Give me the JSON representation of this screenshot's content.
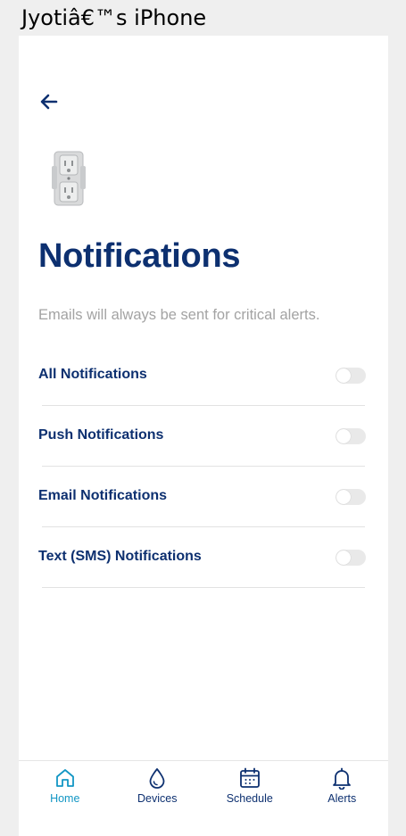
{
  "window": {
    "title": "Jyotiâ€™s iPhone"
  },
  "header": {
    "back_icon": "arrow-left-icon",
    "device_image": "outlet-device-image"
  },
  "page": {
    "title": "Notifications",
    "subtitle": "Emails will always be sent for critical alerts."
  },
  "settings": [
    {
      "label": "All Notifications",
      "enabled": false
    },
    {
      "label": "Push Notifications",
      "enabled": false
    },
    {
      "label": "Email Notifications",
      "enabled": false
    },
    {
      "label": "Text (SMS) Notifications",
      "enabled": false
    }
  ],
  "tabbar": {
    "items": [
      {
        "label": "Home",
        "icon": "home-icon",
        "active": true
      },
      {
        "label": "Devices",
        "icon": "water-drop-icon",
        "active": false
      },
      {
        "label": "Schedule",
        "icon": "calendar-icon",
        "active": false
      },
      {
        "label": "Alerts",
        "icon": "bell-icon",
        "active": false
      }
    ]
  },
  "colors": {
    "primary": "#0d3070",
    "active_tab": "#1296c4",
    "muted_text": "#a3a3a3",
    "toggle_off": "#e9e9e9"
  }
}
